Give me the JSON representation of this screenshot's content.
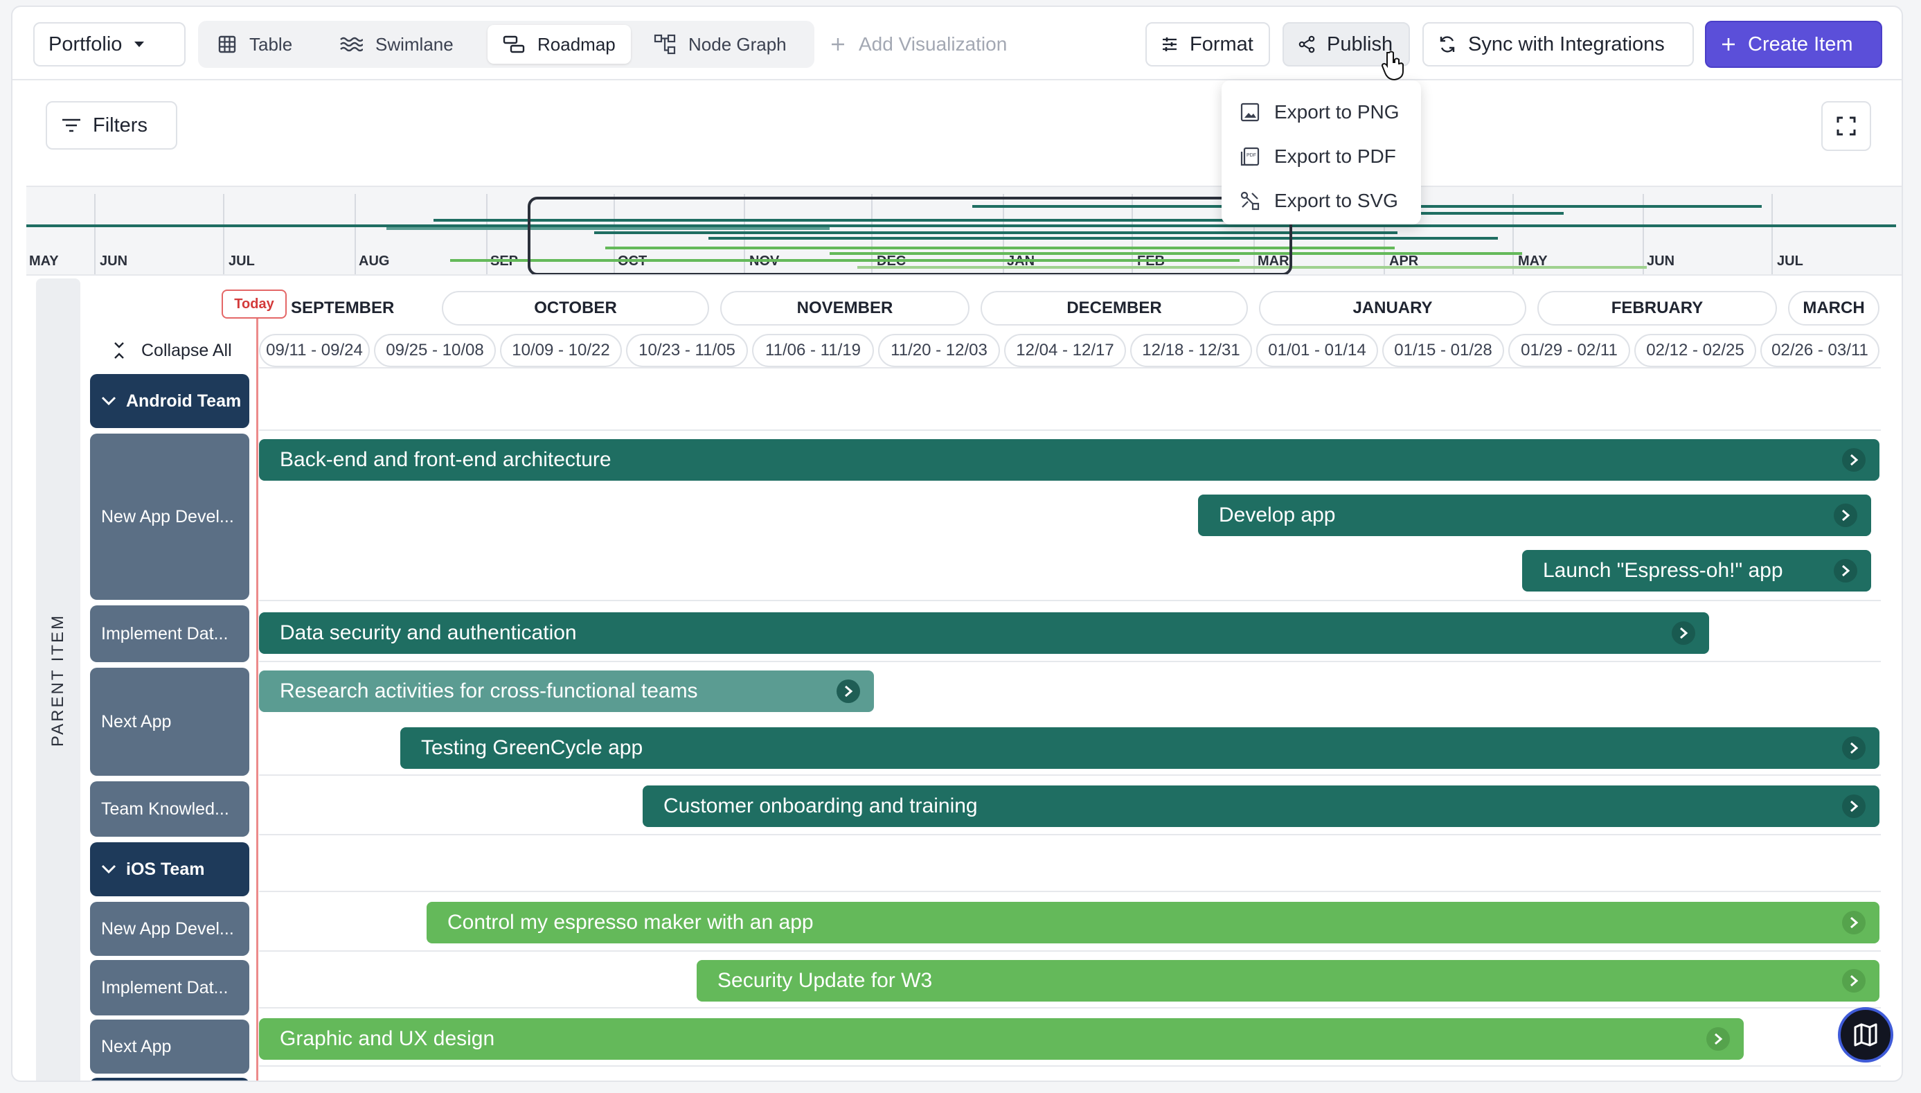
{
  "toolbar": {
    "portfolio_label": "Portfolio",
    "views": [
      {
        "label": "Table",
        "icon": "table-icon",
        "active": false
      },
      {
        "label": "Swimlane",
        "icon": "swimlane-icon",
        "active": false
      },
      {
        "label": "Roadmap",
        "icon": "roadmap-icon",
        "active": true
      },
      {
        "label": "Node Graph",
        "icon": "node-graph-icon",
        "active": false
      }
    ],
    "add_visualization_label": "Add Visualization",
    "format_label": "Format",
    "publish_label": "Publish",
    "sync_label": "Sync with Integrations",
    "create_label": "Create Item",
    "accent_color": "#5b4fd9"
  },
  "publish_menu": {
    "items": [
      "Export to PNG",
      "Export to PDF",
      "Export to SVG"
    ]
  },
  "filters": {
    "filters_label": "Filters"
  },
  "minimap": {
    "months": [
      "MAY",
      "JUN",
      "JUL",
      "AUG",
      "SEP",
      "OCT",
      "NOV",
      "DEC",
      "JAN",
      "FEB",
      "MAR",
      "APR",
      "MAY",
      "JUN",
      "JUL"
    ]
  },
  "timeline": {
    "side_label": "PARENT ITEM",
    "today_label": "Today",
    "collapse_label": "Collapse All",
    "months": [
      "SEPTEMBER",
      "OCTOBER",
      "NOVEMBER",
      "DECEMBER",
      "JANUARY",
      "FEBRUARY",
      "MARCH"
    ],
    "ranges": [
      "09/11 - 09/24",
      "09/25 - 10/08",
      "10/09 - 10/22",
      "10/23 - 11/05",
      "11/06 - 11/19",
      "11/20 - 12/03",
      "12/04 - 12/17",
      "12/18 - 12/31",
      "01/01 - 01/14",
      "01/15 - 01/28",
      "01/29 - 02/11",
      "02/12 - 02/25",
      "02/26 - 03/11"
    ]
  },
  "rows": {
    "android_team": "Android Team",
    "android_new_app": "New App Devel...",
    "android_implement": "Implement Dat...",
    "android_next_app": "Next App",
    "android_team_knowledge": "Team Knowled...",
    "ios_team": "iOS Team",
    "ios_new_app": "New App Devel...",
    "ios_implement": "Implement Dat...",
    "ios_next_app": "Next App"
  },
  "bars": {
    "b1": "Back-end and front-end architecture",
    "b2": "Develop app",
    "b3": "Launch \"Espress-oh!\" app",
    "b4": "Data security and authentication",
    "b5": "Research activities for cross-functional teams",
    "b6": "Testing GreenCycle app",
    "b7": "Customer onboarding and training",
    "b8": "Control my espresso maker with an app",
    "b9": "Security Update for W3",
    "b10": "Graphic and UX design"
  },
  "colors": {
    "android_bar": "#1f6e62",
    "android_bar_light": "#5b9c92",
    "ios_bar": "#64b95a",
    "team_label": "#1e3a5a",
    "today": "#d33a3a"
  }
}
